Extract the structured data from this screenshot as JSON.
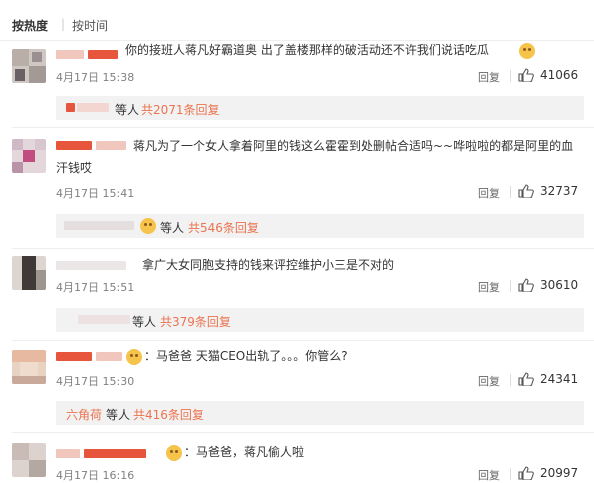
{
  "sort_tabs": {
    "active": "按热度",
    "separator": "|",
    "other": "按时间"
  },
  "comments": [
    {
      "text_line1": "你的接班人蒋凡好霸道奥 出了盖楼那样的破活动还不许我们说话吃瓜",
      "time": "4月17日 15:38",
      "reply_label": "回复",
      "like_count": "41066",
      "sub": {
        "suffix": "等人",
        "link": "共2071条回复"
      }
    },
    {
      "text_line1": "蒋凡为了一个女人拿着阿里的钱这么霍霍到处删帖合适吗~~哗啦啦的都是阿里的血",
      "text_line2": "汗钱哎",
      "time": "4月17日 15:41",
      "reply_label": "回复",
      "like_count": "32737",
      "sub": {
        "suffix": "等人",
        "link": "共546条回复"
      }
    },
    {
      "text_line1": "拿广大女同胞支持的钱来评控维护小三是不对的",
      "time": "4月17日 15:51",
      "reply_label": "回复",
      "like_count": "30610",
      "sub": {
        "suffix": "等人",
        "link": "共379条回复"
      }
    },
    {
      "text_line1": "：马爸爸  天猫CEO出轨了。。。你管么?",
      "time": "4月17日 15:30",
      "reply_label": "回复",
      "like_count": "24341",
      "sub": {
        "prefix": "六角荷",
        "suffix": "等人",
        "link": "共416条回复"
      }
    },
    {
      "text_line1": "：马爸爸，蒋凡偷人啦",
      "time": "4月17日 16:16",
      "reply_label": "回复",
      "like_count": "20997"
    }
  ],
  "colors": {
    "link": "#eb7350",
    "sub_bg": "#f2f2f2",
    "redaction_red": "#e8553d"
  }
}
